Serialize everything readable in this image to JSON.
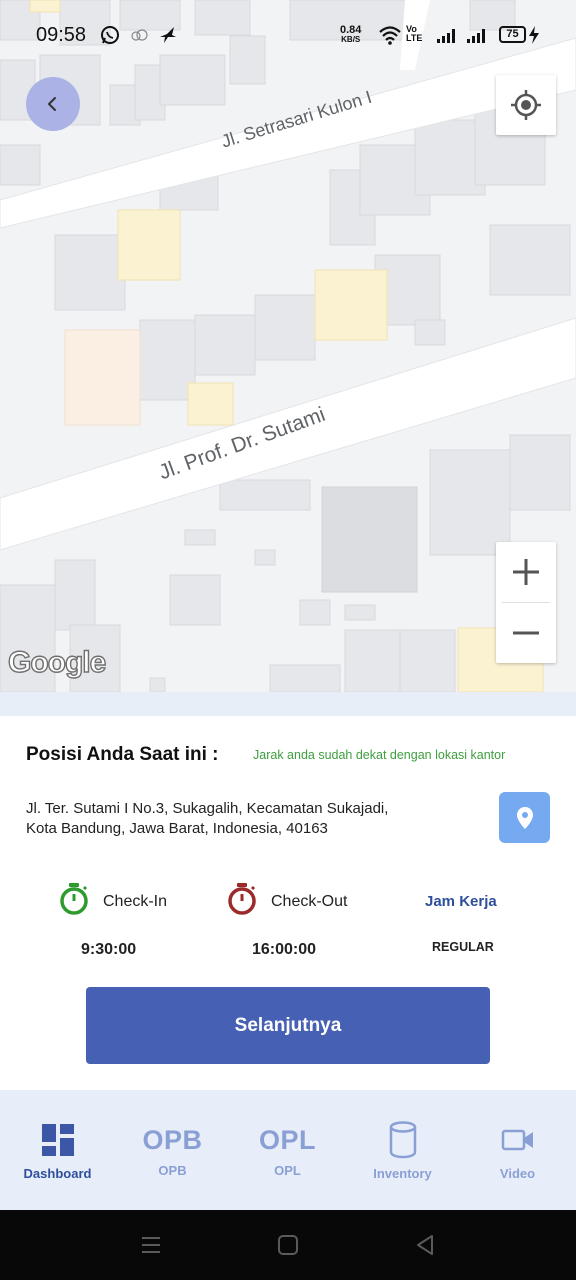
{
  "status_bar": {
    "time": "09:58",
    "net_speed_value": "0.84",
    "net_speed_unit": "KB/S",
    "volte_top": "Vo",
    "volte_bottom": "LTE",
    "battery": "75"
  },
  "map": {
    "streets": [
      "Jl. Setrasari Kulon I",
      "Jl. Prof. Dr. Sutami"
    ],
    "attribution": "Google",
    "icons": {
      "back": "chevron-left-icon",
      "locate": "my-location-icon",
      "zoom_in": "plus-icon",
      "zoom_out": "minus-icon"
    }
  },
  "location": {
    "title": "Posisi Anda Saat ini :",
    "note": "Jarak anda sudah dekat dengan lokasi kantor",
    "address_line1": "Jl. Ter. Sutami I No.3, Sukagalih, Kecamatan Sukajadi,",
    "address_line2": "Kota Bandung, Jawa Barat, Indonesia, 40163",
    "pin_icon": "map-pin-icon"
  },
  "schedule": {
    "checkin_label": "Check-In",
    "checkin_time": "9:30:00",
    "checkout_label": "Check-Out",
    "checkout_time": "16:00:00",
    "jam_kerja_label": "Jam Kerja",
    "jam_kerja_value": "REGULAR",
    "colors": {
      "checkin": "#2e9b2e",
      "checkout": "#9b2b2b",
      "accent": "#2f4f9c"
    }
  },
  "next_button": "Selanjutnya",
  "bottom_nav": {
    "items": [
      {
        "icon": "dashboard-icon",
        "label": "Dashboard",
        "active": true
      },
      {
        "icon_text": "OPB",
        "label": "OPB",
        "active": false
      },
      {
        "icon_text": "OPL",
        "label": "OPL",
        "active": false
      },
      {
        "icon": "database-icon",
        "label": "Inventory",
        "active": false
      },
      {
        "icon": "video-camera-icon",
        "label": "Video",
        "active": false
      }
    ]
  }
}
